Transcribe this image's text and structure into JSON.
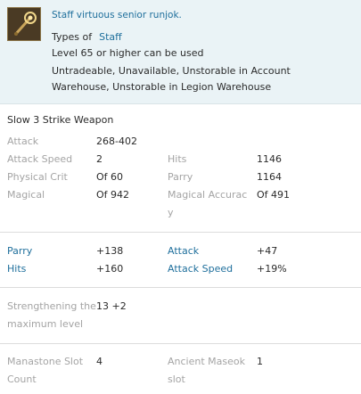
{
  "item": {
    "name": "Staff virtuous senior runjok.",
    "types_label": "Types of",
    "type_value": "Staff",
    "level_req": "Level 65 or higher can be used",
    "restrictions": "Untradeable, Unavailable, Unstorable in Account Warehouse, Unstorable in Legion Warehouse",
    "weapon_type": "Slow 3 Strike Weapon"
  },
  "base_stats": {
    "attack_label": "Attack",
    "attack_value": "268-402",
    "attack_speed_label": "Attack Speed",
    "attack_speed_value": "2",
    "hits_label": "Hits",
    "hits_value": "1146",
    "physical_crit_label": "Physical Crit",
    "physical_crit_value": "Of 60",
    "parry_label": "Parry",
    "parry_value": "1164",
    "magical_label": "Magical",
    "magical_value": "Of 942",
    "magical_accuracy_label": "Magical Accurac\ny",
    "magical_accuracy_value": "Of 491"
  },
  "bonus_stats": {
    "parry_label": "Parry",
    "parry_value": "+138",
    "attack_label": "Attack",
    "attack_value": "+47",
    "hits_label": "Hits",
    "hits_value": "+160",
    "attack_speed_label": "Attack Speed",
    "attack_speed_value": "+19%"
  },
  "enchant": {
    "label": "Strengthening the maximum level",
    "value": "13 +2"
  },
  "slots": {
    "manastone_label": "Manastone Slot Count",
    "manastone_value": "4",
    "ancient_label": "Ancient Maseok slot",
    "ancient_value": "1"
  },
  "colors": {
    "accent": "#1f6f9c",
    "header_bg": "#eaf3f6",
    "muted": "#a4a4a4"
  },
  "icon": "staff-icon"
}
